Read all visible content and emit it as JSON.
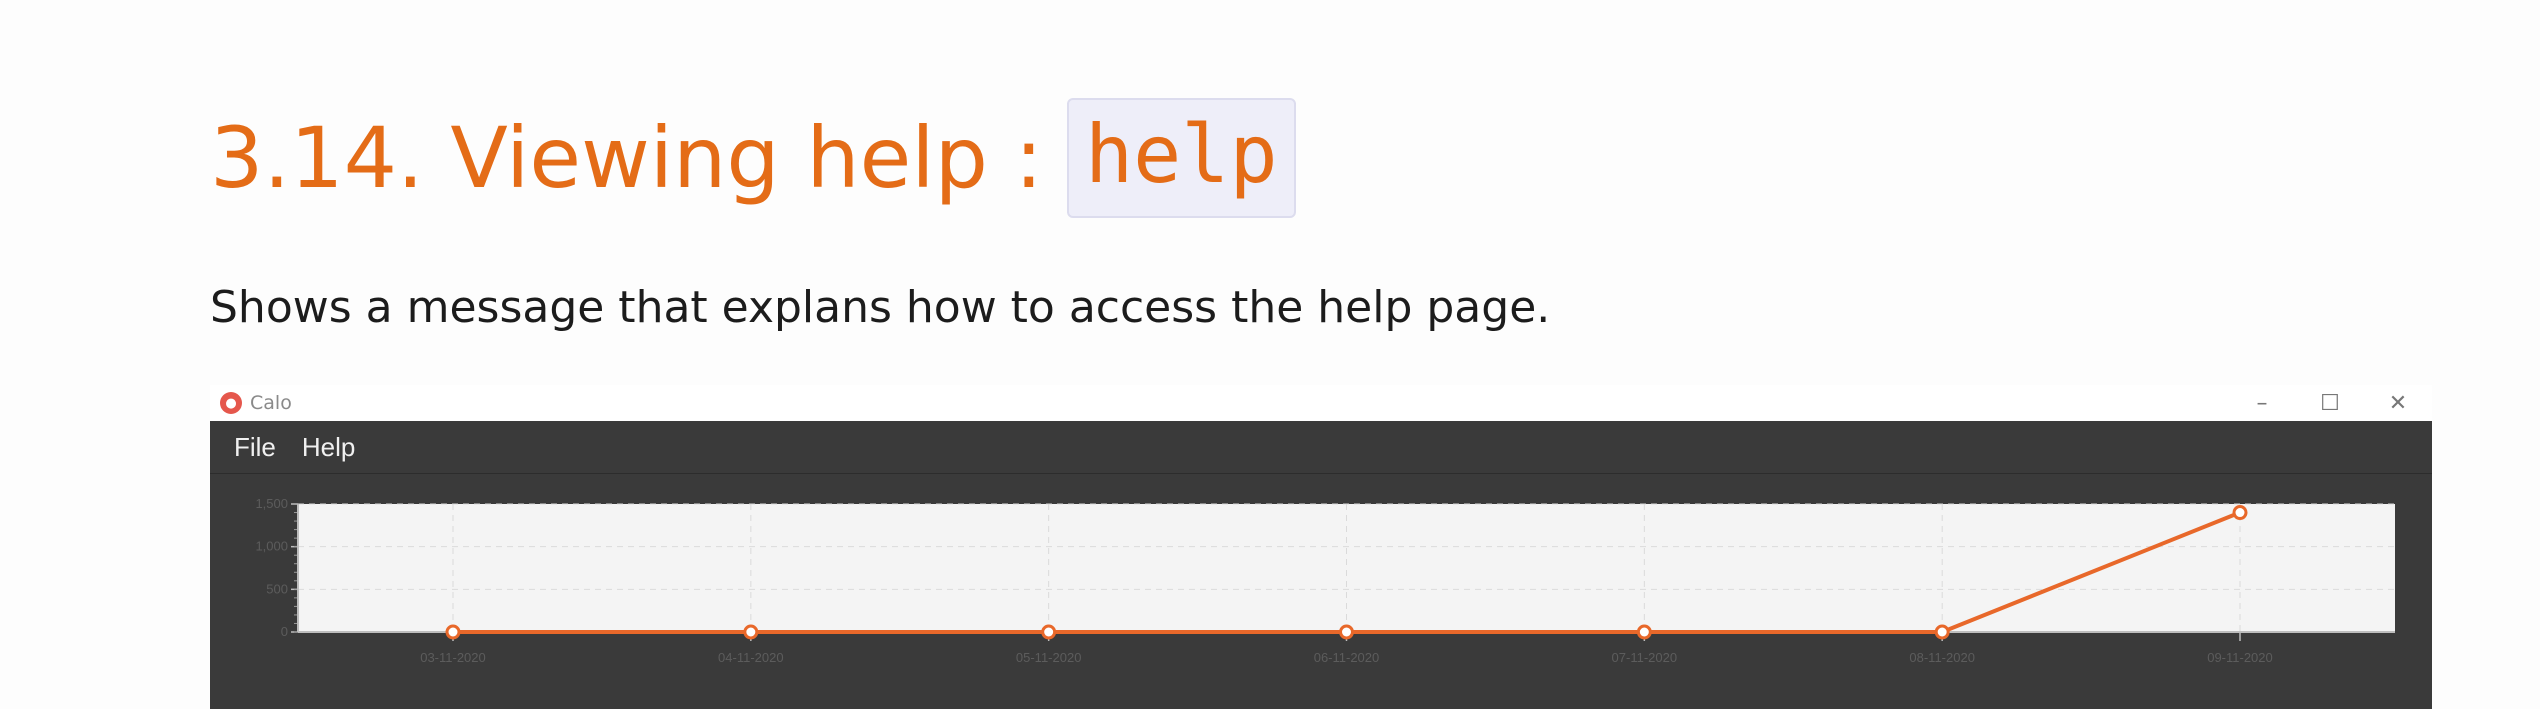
{
  "heading": {
    "text": "3.14. Viewing help :",
    "code": "help"
  },
  "paragraph": "Shows a message that explans how to access the help page.",
  "window": {
    "title": "Calo",
    "controls": {
      "minimize": "–",
      "maximize": "☐",
      "close": "✕"
    },
    "menu": [
      "File",
      "Help"
    ]
  },
  "colors": {
    "heading": "#e46c17",
    "series": "#e8682a",
    "menubar": "#3a3a3a",
    "plot": "#f4f4f4"
  },
  "chart_data": {
    "type": "line",
    "x": [
      "03-11-2020",
      "04-11-2020",
      "05-11-2020",
      "06-11-2020",
      "07-11-2020",
      "08-11-2020",
      "09-11-2020"
    ],
    "series": [
      {
        "values": [
          0,
          0,
          0,
          0,
          0,
          0,
          1400
        ]
      }
    ],
    "ylim": [
      0,
      1500
    ],
    "yticks": [
      0,
      500,
      1000,
      1500
    ],
    "ytick_labels": [
      "0",
      "500",
      "1,000",
      "1,500"
    ],
    "grid": true,
    "title": "",
    "xlabel": "",
    "ylabel": ""
  }
}
